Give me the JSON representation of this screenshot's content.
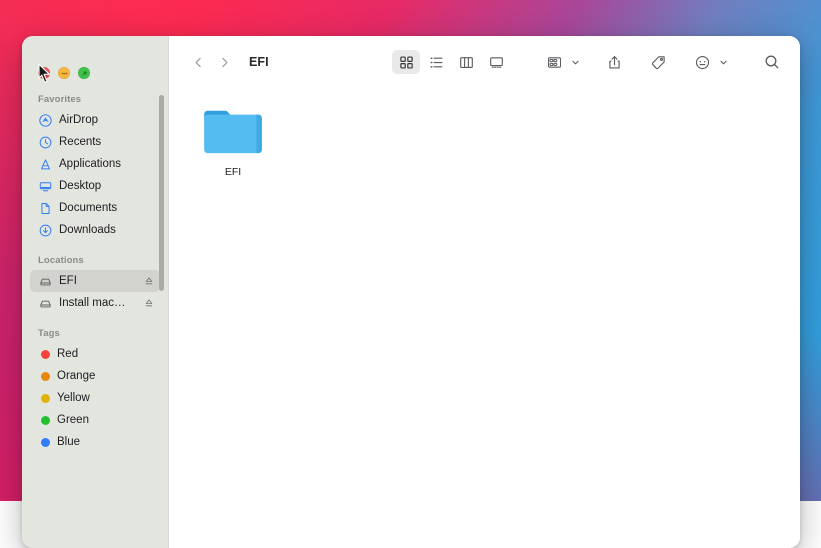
{
  "desktop": {
    "wallpaper_colors": [
      "#ff2d4f",
      "#e62a66",
      "#a8479a",
      "#3f9ad8",
      "#2aa3e0"
    ]
  },
  "window": {
    "title": "EFI",
    "traffic_lights": [
      {
        "name": "close",
        "color": "#ef4f53",
        "glyph": "x"
      },
      {
        "name": "minimize",
        "color": "#f4b63f",
        "glyph": "minus"
      },
      {
        "name": "maximize",
        "color": "#3fc14c",
        "glyph": "expand"
      }
    ]
  },
  "toolbar": {
    "back_label": "Back",
    "forward_label": "Forward",
    "path_title": "EFI",
    "view_modes": [
      {
        "name": "icon-view",
        "label": "Icon View",
        "active": true
      },
      {
        "name": "list-view",
        "label": "List View",
        "active": false
      },
      {
        "name": "column-view",
        "label": "Column View",
        "active": false
      },
      {
        "name": "gallery-view",
        "label": "Gallery View",
        "active": false
      }
    ],
    "group_label": "Group",
    "share_label": "Share",
    "tags_label": "Tags",
    "actions_label": "Actions",
    "search_label": "Search"
  },
  "sidebar": {
    "sections": [
      {
        "title": "Favorites",
        "items": [
          {
            "label": "AirDrop",
            "icon": "airdrop-icon",
            "selected": false,
            "eject": false
          },
          {
            "label": "Recents",
            "icon": "clock-icon",
            "selected": false,
            "eject": false
          },
          {
            "label": "Applications",
            "icon": "applications-icon",
            "selected": false,
            "eject": false
          },
          {
            "label": "Desktop",
            "icon": "desktop-icon",
            "selected": false,
            "eject": false
          },
          {
            "label": "Documents",
            "icon": "document-icon",
            "selected": false,
            "eject": false
          },
          {
            "label": "Downloads",
            "icon": "downloads-icon",
            "selected": false,
            "eject": false
          }
        ]
      },
      {
        "title": "Locations",
        "items": [
          {
            "label": "EFI",
            "icon": "drive-icon",
            "selected": true,
            "eject": true
          },
          {
            "label": "Install mac…",
            "icon": "drive-icon",
            "selected": false,
            "eject": true
          }
        ]
      },
      {
        "title": "Tags",
        "items": [
          {
            "label": "Red",
            "color": "#f4443c",
            "selected": false
          },
          {
            "label": "Orange",
            "color": "#e8860f",
            "selected": false
          },
          {
            "label": "Yellow",
            "color": "#e0b209",
            "selected": false
          },
          {
            "label": "Green",
            "color": "#22c02e",
            "selected": false
          },
          {
            "label": "Blue",
            "color": "#2f7cf6",
            "selected": false
          }
        ]
      }
    ]
  },
  "files": [
    {
      "name": "EFI",
      "type": "folder",
      "color": "#4eb8f0"
    }
  ]
}
